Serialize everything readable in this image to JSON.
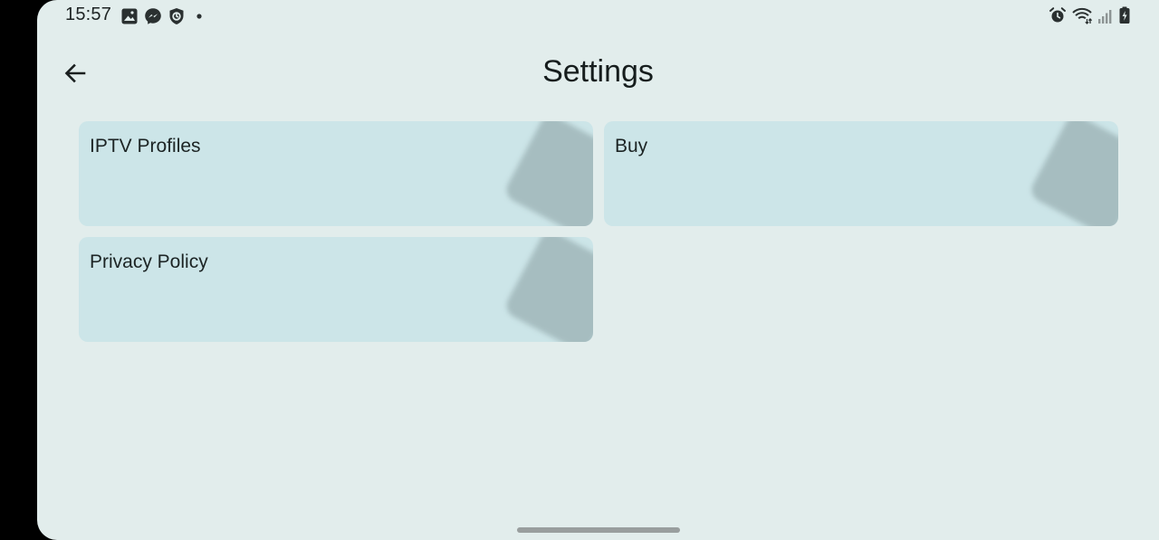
{
  "status_bar": {
    "time": "15:57",
    "left_icons": [
      "gallery-icon",
      "messenger-icon",
      "shield-icon",
      "dot-icon"
    ],
    "right_icons": [
      "alarm-icon",
      "wifi-icon",
      "signal-icon",
      "battery-icon"
    ]
  },
  "header": {
    "title": "Settings",
    "back_icon": "arrow-back-icon"
  },
  "cards": [
    {
      "label": "IPTV Profiles"
    },
    {
      "label": "Buy"
    },
    {
      "label": "Privacy Policy"
    }
  ],
  "colors": {
    "background": "#e2edec",
    "card": "#cce5e8",
    "card_decor": "#a6bdc0",
    "text": "#1c2424"
  }
}
